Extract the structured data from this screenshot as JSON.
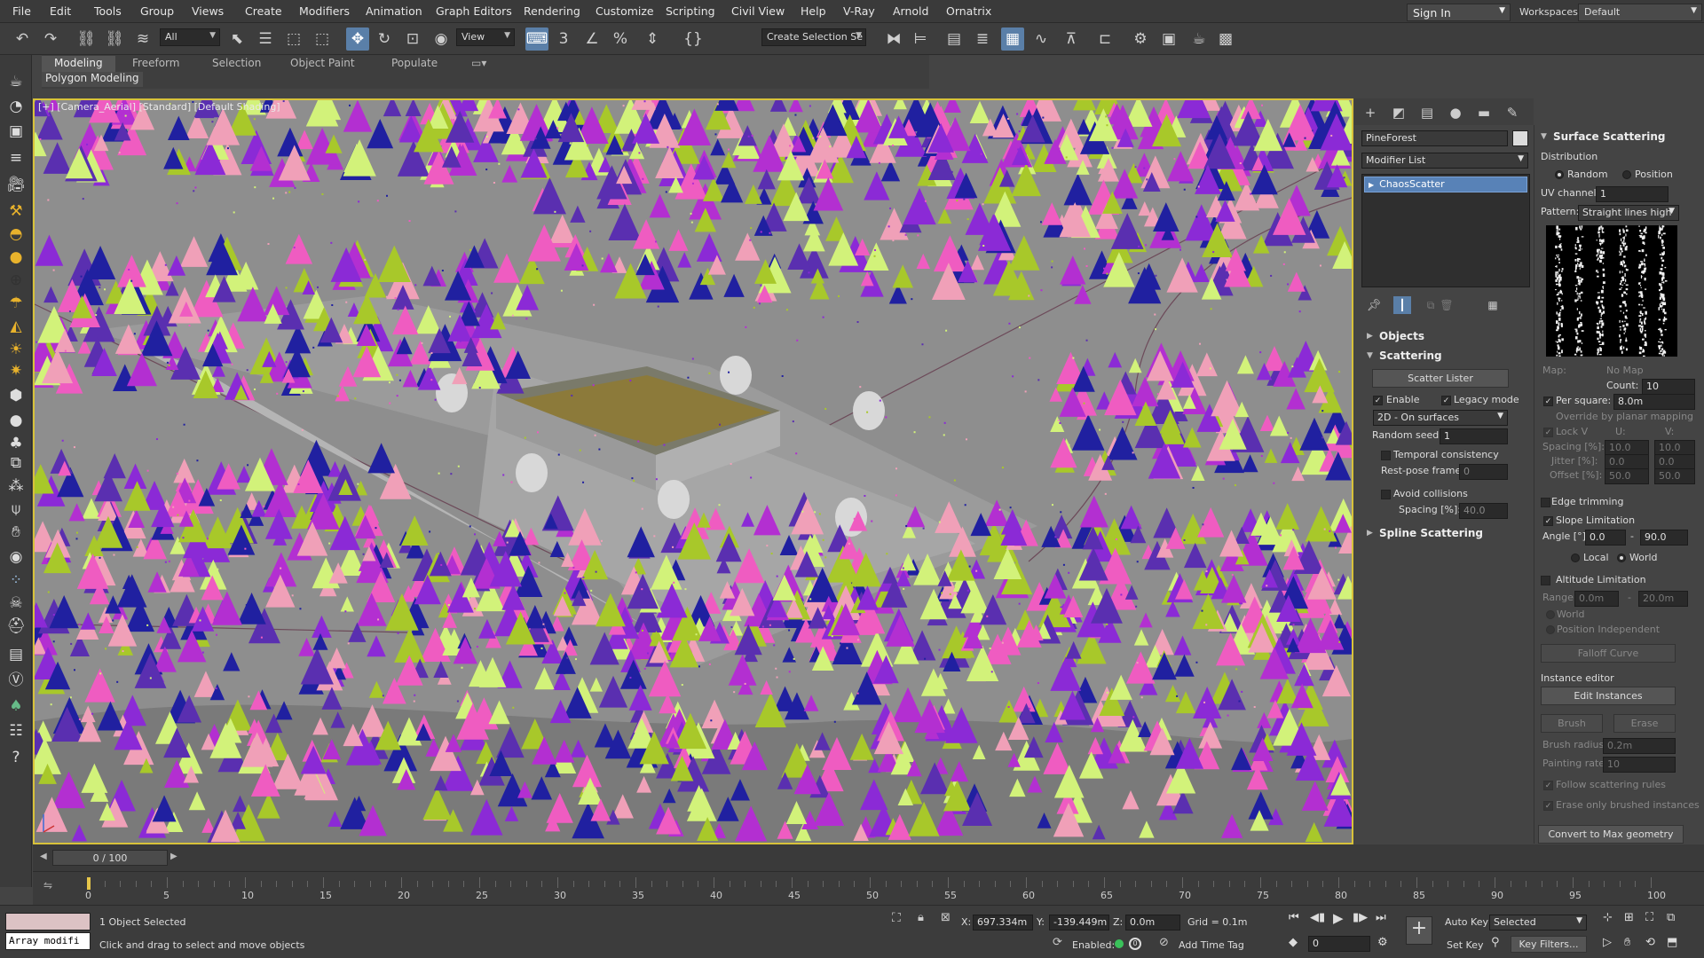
{
  "menu": [
    "File",
    "Edit",
    "Tools",
    "Group",
    "Views",
    "Create",
    "Modifiers",
    "Animation",
    "Graph Editors",
    "Rendering",
    "Customize",
    "Scripting",
    "Civil View",
    "Help",
    "V-Ray",
    "Arnold",
    "Ornatrix"
  ],
  "signin": {
    "label": "Sign In"
  },
  "workspaces": {
    "label": "Workspaces:",
    "value": "Default"
  },
  "toolbar": {
    "filter_value": "All",
    "refcoord_value": "View",
    "named_selection": "Create Selection Se",
    "icons": [
      "undo-icon",
      "redo-icon",
      "link-icon",
      "unlink-icon",
      "bind-spacewarp-icon",
      "select-object-icon",
      "select-by-name-icon",
      "rect-region-icon",
      "window-crossing-icon",
      "select-move-icon",
      "select-rotate-icon",
      "select-scale-icon",
      "select-place-icon",
      "use-pivot-icon",
      "select-manipulate-icon",
      "keyboard-shortcut-icon",
      "snaps-icon",
      "angle-snap-icon",
      "percent-snap-icon",
      "spinner-snap-icon",
      "edit-named-sel-icon",
      "mirror-icon",
      "align-icon",
      "scene-explorer-icon",
      "layer-explorer-icon",
      "ribbon-toggle-icon",
      "curve-editor-icon",
      "schematic-view-icon",
      "material-editor-icon",
      "render-setup-icon",
      "rendered-frame-icon",
      "render-production-icon",
      "render-iterative-icon"
    ]
  },
  "ribbon": {
    "tabs": [
      "Modeling",
      "Freeform",
      "Selection",
      "Object Paint",
      "Populate"
    ],
    "active": "Modeling",
    "sub_label": "Polygon Modeling"
  },
  "viewport": {
    "label": "[+] [Camera_Aerial] [Standard] [Default Shading]"
  },
  "command_panel": {
    "object_name": "PineForest",
    "modifier_list": "Modifier List",
    "stack_item": "ChaosScatter",
    "rollouts": {
      "objects": "Objects",
      "scattering": "Scattering",
      "spline_scattering": "Spline Scattering"
    },
    "scatter_lister": "Scatter Lister",
    "enable_label": "Enable",
    "legacy_label": "Legacy mode",
    "mode_value": "2D - On surfaces",
    "random_seed_label": "Random seed:",
    "random_seed_value": "1",
    "temporal_label": "Temporal consistency",
    "rest_pose_label": "Rest-pose frame:",
    "rest_pose_value": "0",
    "avoid_label": "Avoid collisions",
    "spacing_label": "Spacing [%]:",
    "spacing_value": "40.0"
  },
  "surface": {
    "title": "Surface Scattering",
    "distribution": "Distribution",
    "random": "Random",
    "position": "Position",
    "uv_label": "UV channel:",
    "uv_value": "1",
    "pattern_label": "Pattern:",
    "pattern_value": "Straight lines high",
    "map_label": "Map:",
    "map_value": "No Map",
    "count_label": "Count:",
    "count_value": "10",
    "per_square_label": "Per square:",
    "per_square_value": "8.0m",
    "override_label": "Override by planar mapping",
    "lock_label": "Lock V",
    "u_label": "U:",
    "v_label": "V:",
    "spacing_label": "Spacing [%]:",
    "spacing_u": "10.0",
    "spacing_v": "10.0",
    "jitter_label": "Jitter [%]:",
    "jitter_u": "0.0",
    "jitter_v": "0.0",
    "offset_label": "Offset [%]:",
    "offset_u": "50.0",
    "offset_v": "50.0",
    "edge_label": "Edge trimming",
    "slope_label": "Slope Limitation",
    "angle_label": "Angle [°]:",
    "angle_min": "0.0",
    "angle_max": "90.0",
    "local": "Local",
    "world": "World",
    "altitude_label": "Altitude Limitation",
    "range_label": "Range:",
    "range_min": "0.0m",
    "range_max": "20.0m",
    "world2": "World",
    "pos_indep": "Position Independent",
    "falloff": "Falloff Curve",
    "instance_editor": "Instance editor",
    "edit_instances": "Edit Instances",
    "brush": "Brush",
    "erase": "Erase",
    "brush_radius_label": "Brush radius:",
    "brush_radius_value": "0.2m",
    "painting_rate_label": "Painting rate:",
    "painting_rate_value": "10",
    "follow_label": "Follow scattering rules",
    "erase_only_label": "Erase only brushed instances",
    "convert": "Convert to Max geometry"
  },
  "timeline": {
    "frame": "0 / 100",
    "ticks": [
      "0",
      "5",
      "10",
      "15",
      "20",
      "25",
      "30",
      "35",
      "40",
      "45",
      "50",
      "55",
      "60",
      "65",
      "70",
      "75",
      "80",
      "85",
      "90",
      "95",
      "100"
    ]
  },
  "status": {
    "listener": "Array modifi",
    "selected": "1 Object Selected",
    "prompt": "Click and drag to select and move objects",
    "x_label": "X:",
    "x_value": "697.334m",
    "y_label": "Y:",
    "y_value": "-139.449m",
    "z_label": "Z:",
    "z_value": "0.0m",
    "grid": "Grid = 0.1m",
    "enabled": "Enabled:",
    "add_time_tag": "Add Time Tag",
    "auto_key": "Auto Key",
    "auto_key_value": "Selected",
    "set_key": "Set Key",
    "key_filters": "Key Filters...",
    "frame_value": "0"
  }
}
